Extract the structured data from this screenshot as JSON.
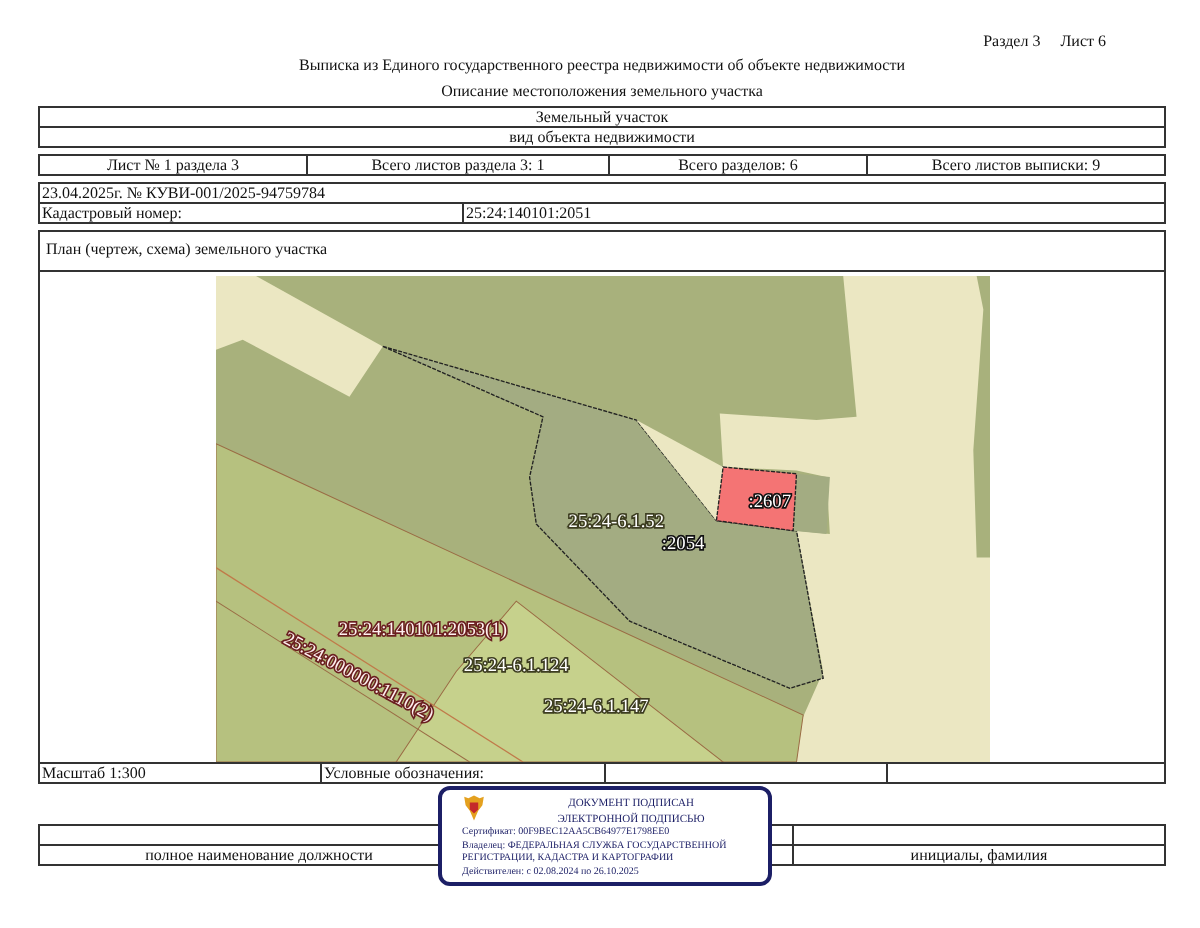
{
  "header": {
    "section": "Раздел 3",
    "sheet": "Лист 6"
  },
  "title": "Выписка из Единого государственного реестра недвижимости об объекте недвижимости",
  "subtitle": "Описание местоположения земельного участка",
  "object": {
    "name": "Земельный участок",
    "caption": "вид объекта недвижимости"
  },
  "sheet_info": [
    "Лист № 1 раздела 3",
    "Всего листов раздела 3: 1",
    "Всего разделов: 6",
    "Всего листов выписки: 9"
  ],
  "record": {
    "date_number": "23.04.2025г. № КУВИ-001/2025-94759784",
    "cadastral_label": "Кадастровый номер:",
    "cadastral_number": "25:24:140101:2051"
  },
  "plan": {
    "title": "План (чертеж, схема) земельного участка",
    "map_labels": [
      {
        "text": "25:24-6.1.52",
        "kind": "zone"
      },
      {
        "text": ":2054",
        "kind": "parcel"
      },
      {
        "text": ":2607",
        "kind": "parcel"
      },
      {
        "text": "25:24:140101:2053(1)",
        "kind": "number"
      },
      {
        "text": "25:24-6.1.124",
        "kind": "zone"
      },
      {
        "text": "25:24:000000:1110(2)",
        "kind": "number"
      },
      {
        "text": "25:24-6.1.147",
        "kind": "zone"
      }
    ]
  },
  "footer_row": {
    "scale": "Масштаб 1:300",
    "legend": "Условные обозначения:"
  },
  "signature": {
    "position_caption": "полное наименование должности",
    "name_caption": "инициалы, фамилия"
  },
  "stamp": {
    "lines": [
      "ДОКУМЕНТ ПОДПИСАН",
      "ЭЛЕКТРОННОЙ ПОДПИСЬЮ"
    ],
    "details": [
      "Сертификат: 00F9BEC12AA5CB64977E1798EE0",
      "Владелец: ФЕДЕРАЛЬНАЯ СЛУЖБА ГОСУДАРСТВЕННОЙ",
      "РЕГИСТРАЦИИ, КАДАСТРА И КАРТОГРАФИИ",
      "Действителен: с 02.08.2024 по 26.10.2025"
    ]
  }
}
